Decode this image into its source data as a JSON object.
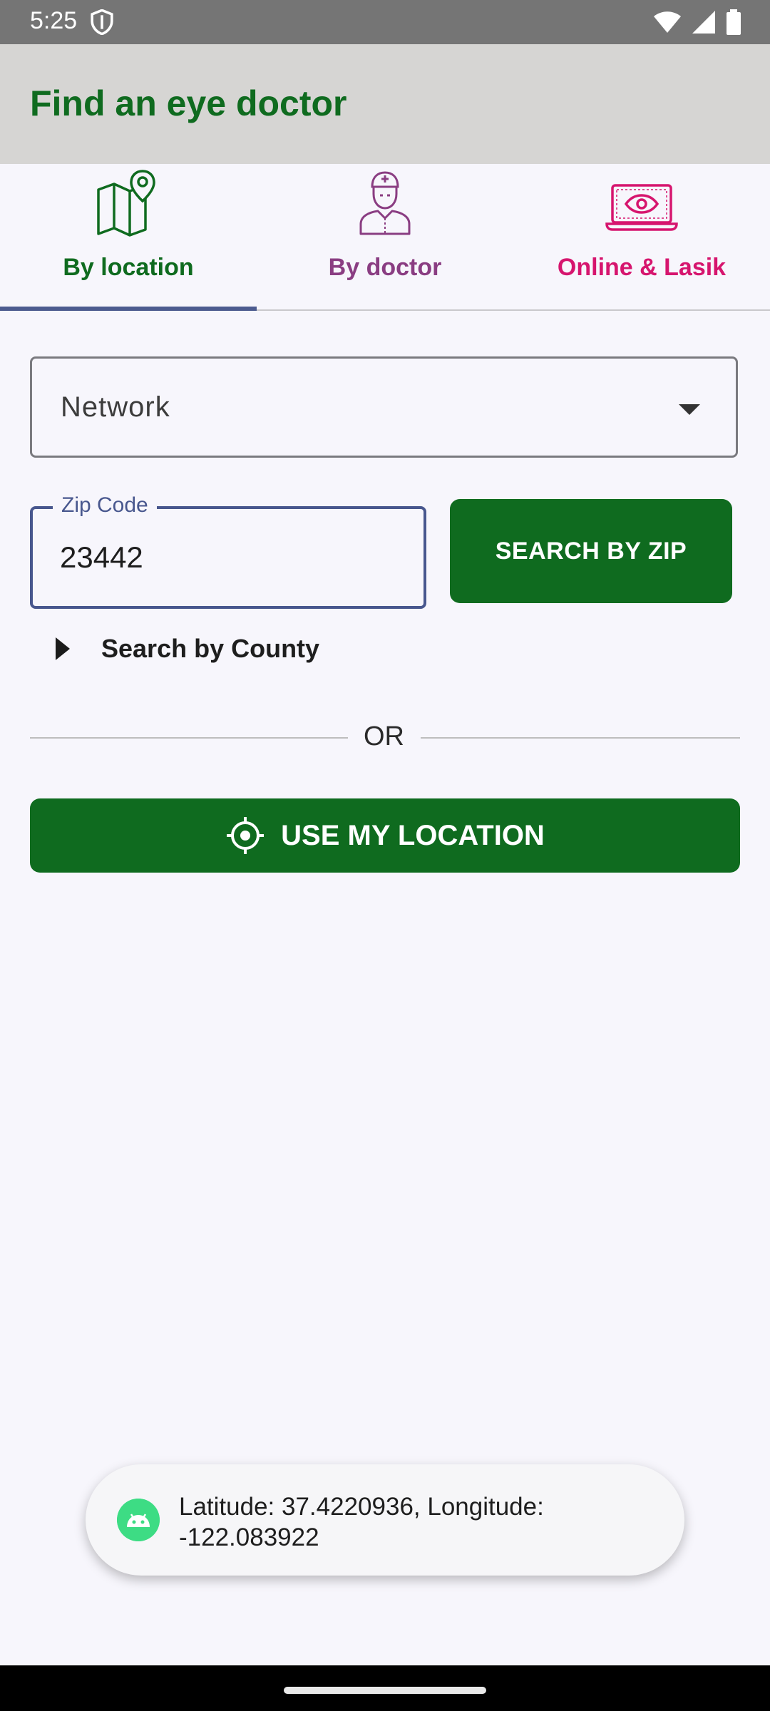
{
  "status_bar": {
    "time": "5:25",
    "icons": [
      "shield-icon",
      "wifi-icon",
      "signal-icon",
      "battery-icon"
    ]
  },
  "app_bar": {
    "title": "Find an eye doctor"
  },
  "tabs": [
    {
      "label": "By location",
      "icon": "map-pin-icon",
      "color": "#0f6b1f",
      "selected": true
    },
    {
      "label": "By doctor",
      "icon": "doctor-icon",
      "color": "#8a3d82",
      "selected": false
    },
    {
      "label": "Online & Lasik",
      "icon": "laptop-eye-icon",
      "color": "#d6156e",
      "selected": false
    }
  ],
  "form": {
    "network_dropdown": {
      "value": "Network"
    },
    "zip": {
      "label": "Zip Code",
      "value": "23442"
    },
    "search_zip_button": "SEARCH BY ZIP",
    "county_toggle": "Search by County",
    "or_text": "OR",
    "use_location_button": "USE MY LOCATION"
  },
  "toast": {
    "message": "Latitude: 37.4220936, Longitude: -122.083922"
  },
  "colors": {
    "brand_green": "#0f6b1f",
    "tab_indicator": "#4c5b8f",
    "background": "#f7f6fc",
    "app_bar": "#d6d5d3"
  }
}
